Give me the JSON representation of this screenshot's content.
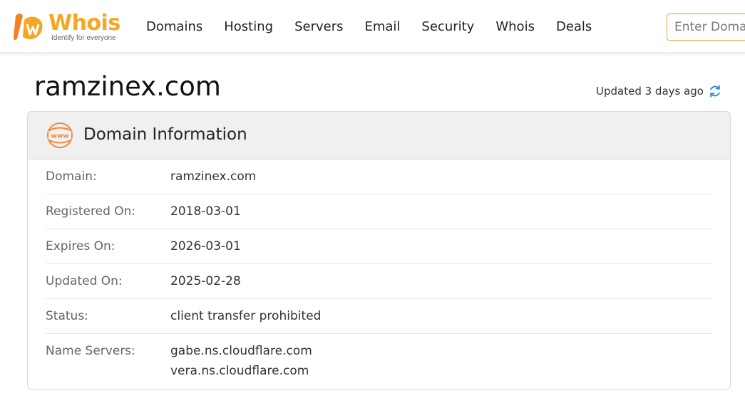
{
  "header": {
    "logo_text": "Whois",
    "logo_tagline": "Identify for everyone",
    "nav": [
      "Domains",
      "Hosting",
      "Servers",
      "Email",
      "Security",
      "Whois",
      "Deals"
    ],
    "search_placeholder": "Enter Domain"
  },
  "page": {
    "domain_title": "ramzinex.com",
    "updated_text": "Updated 3 days ago"
  },
  "card": {
    "title": "Domain Information",
    "www_icon_text": "www",
    "rows": [
      {
        "label": "Domain:",
        "value": "ramzinex.com"
      },
      {
        "label": "Registered On:",
        "value": "2018-03-01"
      },
      {
        "label": "Expires On:",
        "value": "2026-03-01"
      },
      {
        "label": "Updated On:",
        "value": "2025-02-28"
      },
      {
        "label": "Status:",
        "value": "client transfer prohibited"
      }
    ],
    "name_servers": {
      "label": "Name Servers:",
      "values": [
        "gabe.ns.cloudflare.com",
        "vera.ns.cloudflare.com"
      ]
    }
  },
  "colors": {
    "brand_orange": "#f5a623",
    "refresh_blue": "#2f8fd8"
  }
}
